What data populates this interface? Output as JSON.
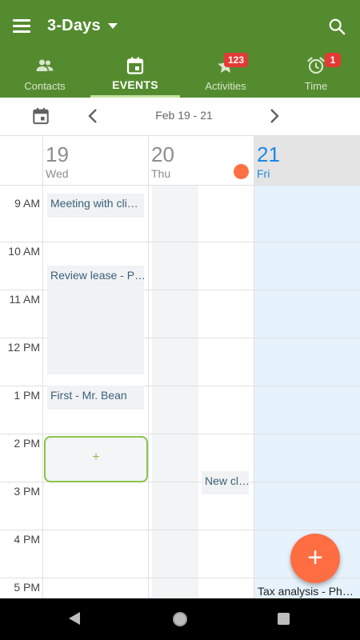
{
  "appbar": {
    "view_title": "3-Days",
    "tabs": [
      {
        "label": "Contacts",
        "icon": "contacts-icon",
        "badge": null
      },
      {
        "label": "EVENTS",
        "icon": "calendar-icon",
        "badge": null,
        "active": true
      },
      {
        "label": "Activities",
        "icon": "star-icon",
        "badge": "123"
      },
      {
        "label": "Time",
        "icon": "alarm-icon",
        "badge": "1"
      }
    ],
    "color": "#558b2f"
  },
  "datebar": {
    "range": "Feb 19 - 21"
  },
  "days": [
    {
      "num": "19",
      "name": "Wed"
    },
    {
      "num": "20",
      "name": "Thu"
    },
    {
      "num": "21",
      "name": "Fri",
      "today": true
    }
  ],
  "hours": [
    "9 AM",
    "10 AM",
    "11 AM",
    "12 PM",
    "1 PM",
    "2 PM",
    "3 PM",
    "4 PM",
    "5 PM"
  ],
  "events": [
    {
      "title": "Meeting with cli…"
    },
    {
      "title": "Review lease - P…"
    },
    {
      "title": "First - Mr. Bean"
    },
    {
      "title": "New cl…"
    },
    {
      "title": "Tax analysis - Ph…"
    }
  ],
  "new_slot": {
    "label": "+"
  },
  "fab": {
    "label": "+"
  },
  "colors": {
    "accent": "#8bc34a",
    "fab": "#ff6d42",
    "today": "#1e88e5",
    "event_text": "#3a5f7a"
  }
}
